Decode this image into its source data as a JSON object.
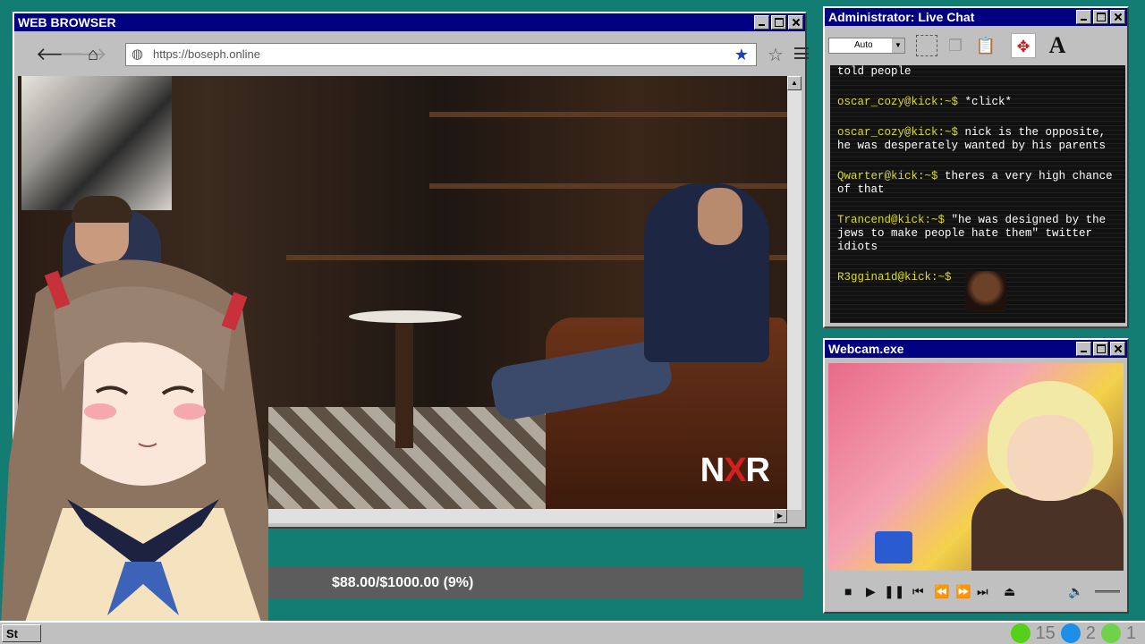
{
  "browser": {
    "title": "WEB BROWSER",
    "url": "https://boseph.online",
    "watermark_left": "N",
    "watermark_x": "X",
    "watermark_right": "R"
  },
  "chat": {
    "title": "Administrator: Live Chat",
    "font_size_select": "Auto",
    "messages": [
      {
        "user": "",
        "text": "told people"
      },
      {
        "user": "oscar_cozy@kick:~$",
        "text": "*click*"
      },
      {
        "user": "oscar_cozy@kick:~$",
        "text": "nick is the opposite, he was desperately wanted by his parents"
      },
      {
        "user": "Qwarter@kick:~$",
        "text": "theres a very high chance of that"
      },
      {
        "user": "Trancend@kick:~$",
        "text": "\"he was designed by the jews to make people hate them\" twitter idiots"
      },
      {
        "user": "R3ggina1d@kick:~$",
        "text": ""
      }
    ]
  },
  "webcam": {
    "title": "Webcam.exe"
  },
  "donation": {
    "text": "$88.00/$1000.00 (9%)",
    "progress": 0.09
  },
  "taskbar": {
    "start_label": "St",
    "tray_count_1": "15",
    "tray_count_2": "2",
    "tray_count_3": "1"
  },
  "colors": {
    "desktop": "#137d74",
    "titlebar": "#000080",
    "chat_username": "#dcdc20",
    "donation_fill": "#2a9d5a"
  }
}
